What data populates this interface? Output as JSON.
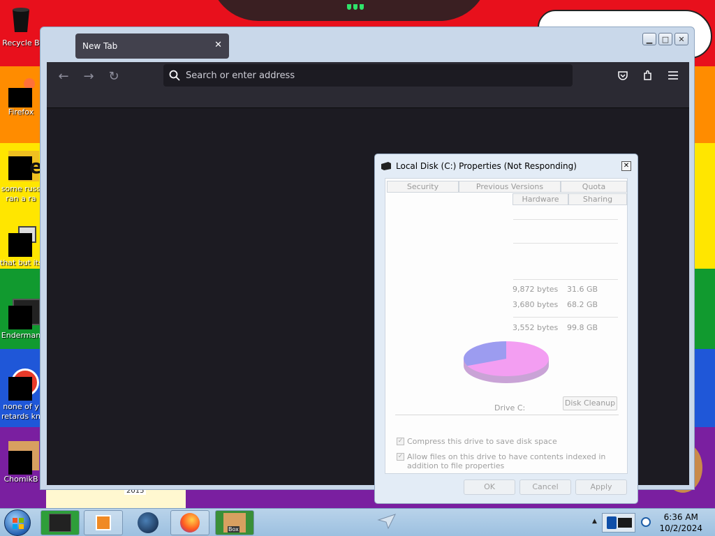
{
  "desktop": {
    "icons": [
      {
        "label": "Recycle B"
      },
      {
        "label": "Firefox"
      },
      {
        "label": "some russ",
        "label2": "ran a ra"
      },
      {
        "label": "that but its"
      },
      {
        "label": "Enderman"
      },
      {
        "label": "none of y",
        "label2": "retards kn"
      },
      {
        "label": "ChomikB"
      }
    ],
    "wallpaper_text": "2015"
  },
  "browser": {
    "tab_title": "New Tab",
    "url_placeholder": "Search or enter address",
    "colors": {
      "toolbar": "#2b2a33",
      "content": "#1c1b22",
      "tab": "#42414d"
    }
  },
  "dialog": {
    "title": "Local Disk (C:) Properties (Not Responding)",
    "tabs_row1": [
      "Security",
      "Previous Versions",
      "Quota"
    ],
    "tabs_row2": [
      "Hardware",
      "Sharing"
    ],
    "used_bytes": "9,872 bytes",
    "used_gb": "31.6 GB",
    "free_bytes": "3,680 bytes",
    "free_gb": "68.2 GB",
    "capacity_bytes": "3,552 bytes",
    "capacity_gb": "99.8 GB",
    "used_fraction": 0.317,
    "drive_label": "Drive C:",
    "cleanup_button": "Disk Cleanup",
    "compress_label": "Compress this drive to save disk space",
    "index_label": "Allow files on this drive to have contents indexed in addition to file properties",
    "ok": "OK",
    "cancel": "Cancel",
    "apply": "Apply"
  },
  "taskbar": {
    "time": "6:36 AM",
    "date": "10/2/2024",
    "items": [
      "explorer-window",
      "media-player",
      "steam",
      "firefox",
      "chomik-box"
    ],
    "box_label": "Box"
  }
}
